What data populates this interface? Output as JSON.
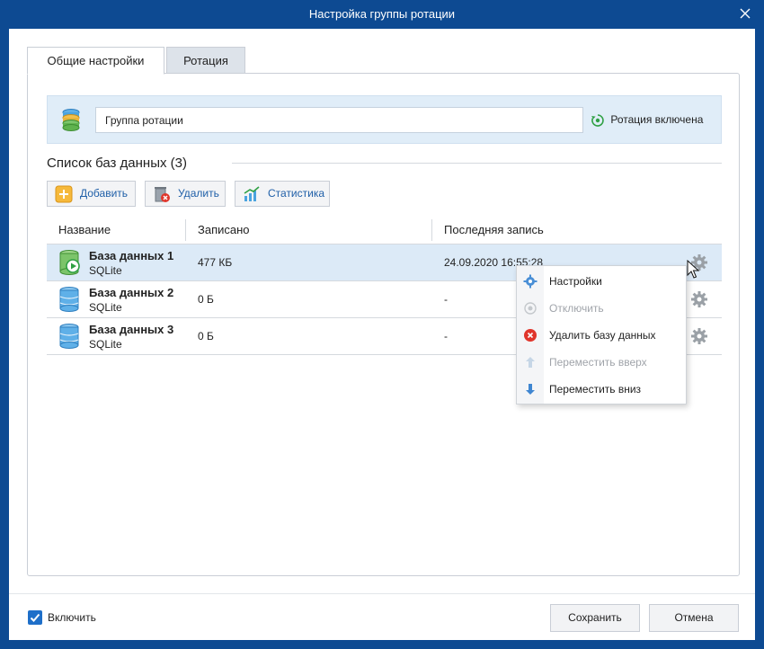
{
  "window": {
    "title": "Настройка группы ротации"
  },
  "tabs": [
    {
      "label": "Общие настройки",
      "active": true
    },
    {
      "label": "Ротация",
      "active": false
    }
  ],
  "group": {
    "name_value": "Группа ротации",
    "status_label": "Ротация включена",
    "status_color": "#2ea043"
  },
  "db_list": {
    "title": "Список баз данных (3)",
    "toolbar": {
      "add_label": "Добавить",
      "delete_label": "Удалить",
      "stats_label": "Статистика"
    },
    "columns": [
      "Название",
      "Записано",
      "Последняя запись"
    ],
    "rows": [
      {
        "name": "База данных 1",
        "type": "SQLite",
        "written": "477 КБ",
        "last": "24.09.2020 16:55:28",
        "active": true
      },
      {
        "name": "База данных 2",
        "type": "SQLite",
        "written": "0 Б",
        "last": "-",
        "active": false
      },
      {
        "name": "База данных 3",
        "type": "SQLite",
        "written": "0 Б",
        "last": "-",
        "active": false
      }
    ]
  },
  "context_menu": {
    "items": [
      {
        "label": "Настройки",
        "icon": "gear-icon",
        "enabled": true
      },
      {
        "label": "Отключить",
        "icon": "disable-icon",
        "enabled": false
      },
      {
        "label": "Удалить базу данных",
        "icon": "remove-icon",
        "enabled": true
      },
      {
        "label": "Переместить вверх",
        "icon": "arrow-up-icon",
        "enabled": false
      },
      {
        "label": "Переместить вниз",
        "icon": "arrow-down-icon",
        "enabled": true
      }
    ]
  },
  "footer": {
    "enable_label": "Включить",
    "enable_checked": true,
    "save_label": "Сохранить",
    "cancel_label": "Отмена"
  },
  "colors": {
    "titlebar": "#0d4a92",
    "accent": "#1e6fc9",
    "selected_row": "#dceaf7",
    "group_bar": "#e0edf8",
    "delete_red": "#e0352b"
  }
}
